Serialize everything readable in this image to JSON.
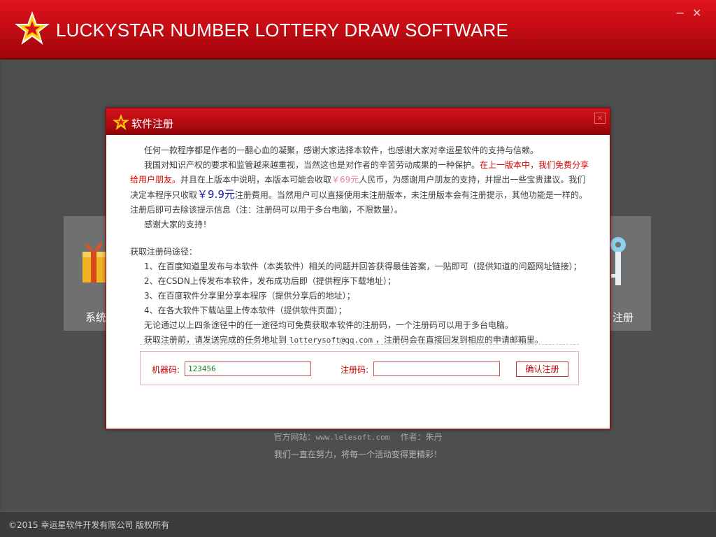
{
  "window": {
    "title": "LUCKYSTAR NUMBER LOTTERY DRAW SOFTWARE",
    "minimize_glyph": "−",
    "close_glyph": "✕"
  },
  "background": {
    "tile_left_label": "系统",
    "tile_right_label": "注册",
    "site_label": "官方网站：",
    "site_url": "www.lelesoft.com",
    "author_label": "作者：朱丹",
    "slogan": "我们一直在努力，将每一个活动变得更精彩！"
  },
  "footer": {
    "copyright": "©2015  幸运星软件开发有限公司    版权所有"
  },
  "dialog": {
    "title": "软件注册",
    "close_glyph": "×",
    "p1": "任何一款程序都是作者的一翻心血的凝聚，感谢大家选择本软件，也感谢大家对幸运星软件的支持与信赖。",
    "p2_a": "我国对知识产权的要求和监管越来越重视，当然这也是对作者的辛苦劳动成果的一种保护。",
    "p2_red": "在上一版本中，我们免费分享给用户朋友。",
    "p2_b": "并且在上版本中说明，本版本可能会收取",
    "p2_old_price": "￥69元",
    "p2_c": "人民币，为感谢用户朋友的支持，并提出一些宝贵建议。我们决定本程序只收取",
    "p2_price": "￥9.9元",
    "p2_d": "注册费用。当然用户可以直接使用未注册版本，未注册版本会有注册提示，其他功能是一样的。注册后即可去除该提示信息（注：注册码可以用于多台电脑，不限数量）。",
    "p3": "感谢大家的支持！",
    "ways_title": "获取注册码途径：",
    "ways": [
      "1、在百度知道里发布与本软件（本类软件）相关的问题并回答获得最佳答案，一贴即可（提供知道的问题网址链接）；",
      "2、在CSDN上传发布本软件，发布成功后即（提供程序下载地址）；",
      "3、在百度软件分享里分享本程序（提供分享后的地址）；",
      "4、在各大软件下载站里上传本软件（提供软件页面）；"
    ],
    "note1": "无论通过以上四条途径中的任一途径均可免费获取本软件的注册码，一个注册码可以用于多台电脑。",
    "note2_a": "获取注册前，请发送完成的任务地址到 ",
    "note2_email": "lotterysoft@qq.com",
    "note2_b": " ，注册码会在直接回发到相应的申请邮箱里。",
    "machine_code_label": "机器码:",
    "machine_code_value": "123456",
    "reg_code_label": "注册码:",
    "reg_code_value": "",
    "confirm_label": "确认注册"
  },
  "colors": {
    "brand_red": "#c50c14",
    "star_yellow": "#ffd200",
    "background_gray": "#4e4e4e"
  }
}
